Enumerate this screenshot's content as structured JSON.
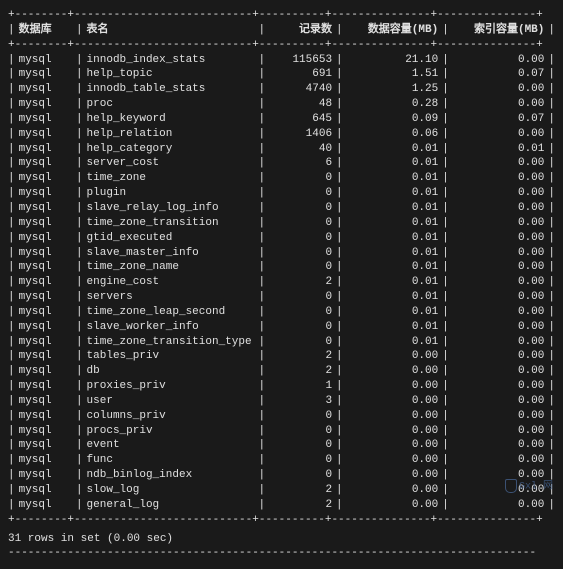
{
  "headers": {
    "db": "数据库",
    "table": "表名",
    "records": "记录数",
    "data_mb": "数据容量(MB)",
    "index_mb": "索引容量(MB)"
  },
  "chart_data": {
    "type": "table",
    "columns": [
      "数据库",
      "表名",
      "记录数",
      "数据容量(MB)",
      "索引容量(MB)"
    ],
    "rows": [
      {
        "db": "mysql",
        "table": "innodb_index_stats",
        "records": 115653,
        "data_mb": "21.10",
        "index_mb": "0.00"
      },
      {
        "db": "mysql",
        "table": "help_topic",
        "records": 691,
        "data_mb": "1.51",
        "index_mb": "0.07"
      },
      {
        "db": "mysql",
        "table": "innodb_table_stats",
        "records": 4740,
        "data_mb": "1.25",
        "index_mb": "0.00"
      },
      {
        "db": "mysql",
        "table": "proc",
        "records": 48,
        "data_mb": "0.28",
        "index_mb": "0.00"
      },
      {
        "db": "mysql",
        "table": "help_keyword",
        "records": 645,
        "data_mb": "0.09",
        "index_mb": "0.07"
      },
      {
        "db": "mysql",
        "table": "help_relation",
        "records": 1406,
        "data_mb": "0.06",
        "index_mb": "0.00"
      },
      {
        "db": "mysql",
        "table": "help_category",
        "records": 40,
        "data_mb": "0.01",
        "index_mb": "0.01"
      },
      {
        "db": "mysql",
        "table": "server_cost",
        "records": 6,
        "data_mb": "0.01",
        "index_mb": "0.00"
      },
      {
        "db": "mysql",
        "table": "time_zone",
        "records": 0,
        "data_mb": "0.01",
        "index_mb": "0.00"
      },
      {
        "db": "mysql",
        "table": "plugin",
        "records": 0,
        "data_mb": "0.01",
        "index_mb": "0.00"
      },
      {
        "db": "mysql",
        "table": "slave_relay_log_info",
        "records": 0,
        "data_mb": "0.01",
        "index_mb": "0.00"
      },
      {
        "db": "mysql",
        "table": "time_zone_transition",
        "records": 0,
        "data_mb": "0.01",
        "index_mb": "0.00"
      },
      {
        "db": "mysql",
        "table": "gtid_executed",
        "records": 0,
        "data_mb": "0.01",
        "index_mb": "0.00"
      },
      {
        "db": "mysql",
        "table": "slave_master_info",
        "records": 0,
        "data_mb": "0.01",
        "index_mb": "0.00"
      },
      {
        "db": "mysql",
        "table": "time_zone_name",
        "records": 0,
        "data_mb": "0.01",
        "index_mb": "0.00"
      },
      {
        "db": "mysql",
        "table": "engine_cost",
        "records": 2,
        "data_mb": "0.01",
        "index_mb": "0.00"
      },
      {
        "db": "mysql",
        "table": "servers",
        "records": 0,
        "data_mb": "0.01",
        "index_mb": "0.00"
      },
      {
        "db": "mysql",
        "table": "time_zone_leap_second",
        "records": 0,
        "data_mb": "0.01",
        "index_mb": "0.00"
      },
      {
        "db": "mysql",
        "table": "slave_worker_info",
        "records": 0,
        "data_mb": "0.01",
        "index_mb": "0.00"
      },
      {
        "db": "mysql",
        "table": "time_zone_transition_type",
        "records": 0,
        "data_mb": "0.01",
        "index_mb": "0.00"
      },
      {
        "db": "mysql",
        "table": "tables_priv",
        "records": 2,
        "data_mb": "0.00",
        "index_mb": "0.00"
      },
      {
        "db": "mysql",
        "table": "db",
        "records": 2,
        "data_mb": "0.00",
        "index_mb": "0.00"
      },
      {
        "db": "mysql",
        "table": "proxies_priv",
        "records": 1,
        "data_mb": "0.00",
        "index_mb": "0.00"
      },
      {
        "db": "mysql",
        "table": "user",
        "records": 3,
        "data_mb": "0.00",
        "index_mb": "0.00"
      },
      {
        "db": "mysql",
        "table": "columns_priv",
        "records": 0,
        "data_mb": "0.00",
        "index_mb": "0.00"
      },
      {
        "db": "mysql",
        "table": "procs_priv",
        "records": 0,
        "data_mb": "0.00",
        "index_mb": "0.00"
      },
      {
        "db": "mysql",
        "table": "event",
        "records": 0,
        "data_mb": "0.00",
        "index_mb": "0.00"
      },
      {
        "db": "mysql",
        "table": "func",
        "records": 0,
        "data_mb": "0.00",
        "index_mb": "0.00"
      },
      {
        "db": "mysql",
        "table": "ndb_binlog_index",
        "records": 0,
        "data_mb": "0.00",
        "index_mb": "0.00"
      },
      {
        "db": "mysql",
        "table": "slow_log",
        "records": 2,
        "data_mb": "0.00",
        "index_mb": "0.00"
      },
      {
        "db": "mysql",
        "table": "general_log",
        "records": 2,
        "data_mb": "0.00",
        "index_mb": "0.00"
      }
    ]
  },
  "footer": "31 rows in set (0.00 sec)",
  "watermark": "Gxl 网",
  "sep_plus": "+--------+---------------------------+----------+---------------+---------------+",
  "sep_dash": "--------------------------------------------------------------------------------"
}
